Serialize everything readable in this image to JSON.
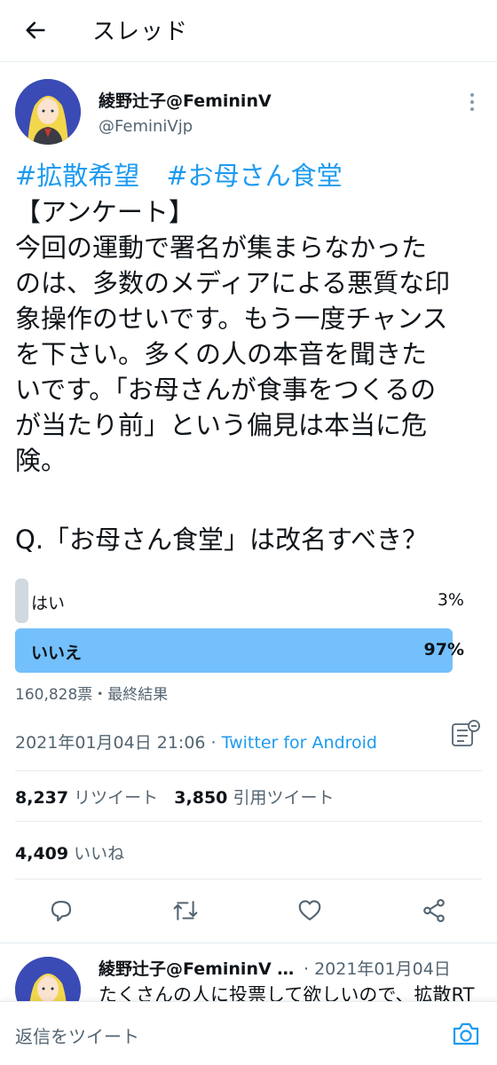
{
  "header": {
    "title": "スレッド",
    "back_icon": "arrow-left-icon"
  },
  "tweet": {
    "author_name": "綾野辻子@FemininV",
    "author_handle": "@FeminiVjp",
    "hashtags": [
      "#拡散希望",
      "#お母さん食堂"
    ],
    "text": "【アンケート】\n今回の運動で署名が集まらなかった\nのは、多数のメディアによる悪質な印\n象操作のせいです。もう一度チャンス\nを下さい。多くの人の本音を聞きた\nいです。「お母さんが食事をつくるの\nが当たり前」という偏見は本当に危\n険。",
    "question": "Q.「お母さん食堂」は改名すべき？",
    "poll": {
      "options": [
        {
          "label": "はい",
          "percent_text": "3%",
          "percent": 3
        },
        {
          "label": "いいえ",
          "percent_text": "97%",
          "percent": 97
        }
      ],
      "meta": "160,828票・最終結果"
    },
    "timestamp": "2021年01月04日 21:06",
    "timestamp_separator": " · ",
    "source": "Twitter for Android",
    "stats": {
      "retweets": "8,237",
      "retweets_label": "リツイート",
      "quotes": "3,850",
      "quotes_label": "引用ツイート",
      "likes": "4,409",
      "likes_label": "いいね"
    }
  },
  "reply": {
    "author_name": "綾野辻子@FemininV …",
    "date": "· 2021年01月04日",
    "text": "たくさんの人に投票して欲しいので、拡散RT"
  },
  "reply_bar": {
    "placeholder": "返信をツイート"
  },
  "colors": {
    "accent": "#1d9bf0",
    "poll_winner": "#74c0fc",
    "poll_loser": "#cfd9de",
    "secondary_text": "#536471"
  },
  "icons": [
    "arrow-left-icon",
    "more-icon",
    "analytics-icon",
    "reply-icon",
    "retweet-icon",
    "like-icon",
    "share-icon",
    "camera-icon"
  ]
}
